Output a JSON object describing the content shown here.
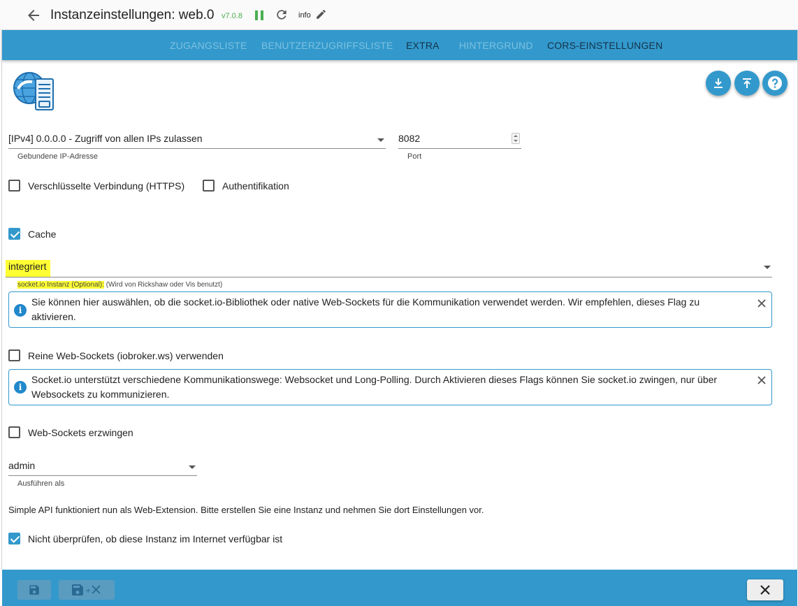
{
  "header": {
    "title": "Instanzeinstellungen: web.0",
    "version": "v7.0.8",
    "log_level": "info"
  },
  "tabs": [
    {
      "label": "ZUGANGSLISTE",
      "active": false
    },
    {
      "label": "BENUTZERZUGRIFFSLISTE",
      "active": false
    },
    {
      "label": "EXTRA",
      "active": true
    },
    {
      "label": "HINTERGRUND",
      "active": false
    },
    {
      "label": "CORS-EINSTELLUNGEN",
      "active": false
    }
  ],
  "icons": {
    "back": "arrow-left-icon",
    "pause": "pause-icon",
    "reload": "reload-icon",
    "edit": "pencil-icon",
    "download": "download-icon",
    "upload": "upload-icon",
    "help": "help-icon"
  },
  "form": {
    "bind_ip": {
      "value": "[IPv4] 0.0.0.0 - Zugriff von allen IPs zulassen",
      "helper": "Gebundene IP-Adresse"
    },
    "port": {
      "value": "8082",
      "helper": "Port"
    },
    "https": {
      "label": "Verschlüsselte Verbindung (HTTPS)",
      "checked": false
    },
    "auth": {
      "label": "Authentifikation",
      "checked": false
    },
    "cache": {
      "label": "Cache",
      "checked": true
    },
    "socketio": {
      "value": "integriert",
      "helper_highlight": "socket.io Instanz (Optional):",
      "helper_rest": " (Wird von Rickshaw oder Vis benutzt)"
    },
    "alert1": "Sie können hier auswählen, ob die socket.io-Bibliothek oder native Web-Sockets für die Kommunikation verwendet werden. Wir empfehlen, dieses Flag zu aktivieren.",
    "pure_ws": {
      "label": "Reine Web-Sockets (iobroker.ws) verwenden",
      "checked": false
    },
    "alert2": "Socket.io unterstützt verschiedene Kommunikationswege: Websocket und Long-Polling. Durch Aktivieren dieses Flags können Sie socket.io zwingen, nur über Websockets zu kommunizieren.",
    "force_ws": {
      "label": "Web-Sockets erzwingen",
      "checked": false
    },
    "run_as": {
      "value": "admin",
      "helper": "Ausführen als"
    },
    "simple_api_note": "Simple API funktioniert nun als Web-Extension. Bitte erstellen Sie eine Instanz und nehmen Sie dort Einstellungen vor.",
    "no_check": {
      "label": "Nicht überprüfen, ob diese Instanz im Internet verfügbar ist",
      "checked": true
    }
  },
  "colors": {
    "accent": "#3399cc",
    "version_green": "#4caf50",
    "highlight": "#ffff33"
  }
}
